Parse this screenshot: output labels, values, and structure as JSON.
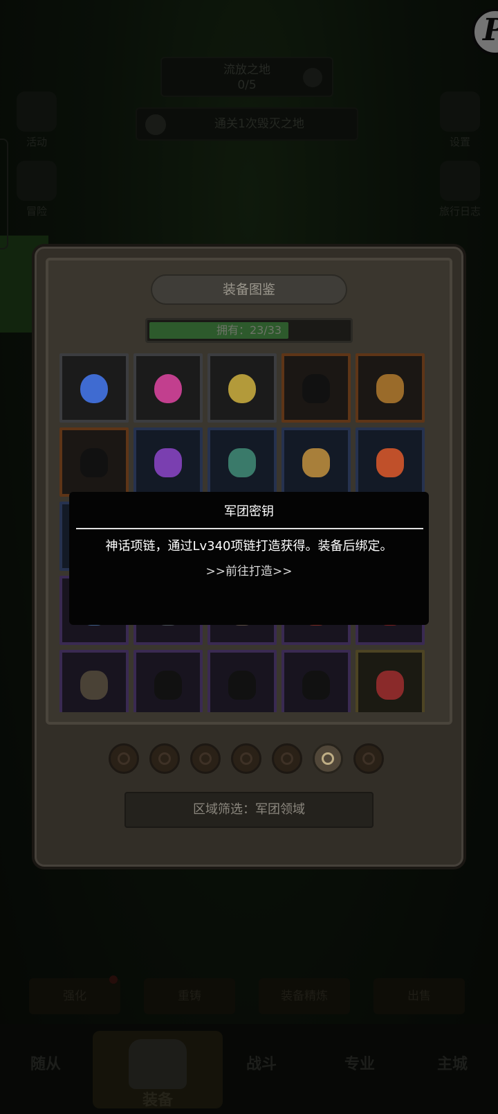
{
  "background": {
    "stage": {
      "name": "流放之地",
      "progress": "0/5"
    },
    "quest": "通关1次毁灭之地",
    "left_menu": [
      "活动",
      "冒险"
    ],
    "right_menu": [
      "设置",
      "旅行日志"
    ],
    "actions": [
      "强化",
      "重铸",
      "装备精炼",
      "出售"
    ],
    "tabs": [
      "随从",
      "装备",
      "战斗",
      "专业",
      "主城"
    ],
    "active_tab": "装备",
    "corner_logo": "P"
  },
  "panel": {
    "title": "装备图鉴",
    "owned_label": "拥有：23/33",
    "owned_fraction": 0.697,
    "grid": [
      [
        {
          "rarity": "grey",
          "icon": "blue-egg-necklace-icon",
          "color": "#3f6bd1"
        },
        {
          "rarity": "grey",
          "icon": "pink-egg-necklace-icon",
          "color": "#c23f8e"
        },
        {
          "rarity": "grey",
          "icon": "gold-egg-necklace-icon",
          "color": "#b39a3a"
        },
        {
          "rarity": "orange",
          "icon": "locked-silhouette-icon",
          "color": "#111111"
        },
        {
          "rarity": "orange",
          "icon": "winged-amulet-icon",
          "color": "#9a6b2a"
        }
      ],
      [
        {
          "rarity": "orange",
          "icon": "locked-silhouette-icon",
          "color": "#111111"
        },
        {
          "rarity": "blue",
          "icon": "purple-orb-amulet-icon",
          "color": "#7a3fb0"
        },
        {
          "rarity": "blue",
          "icon": "spiked-ring-amulet-icon",
          "color": "#3a7a6a"
        },
        {
          "rarity": "blue",
          "icon": "horned-amulet-icon",
          "color": "#a87f3a"
        },
        {
          "rarity": "blue",
          "icon": "ruby-locket-icon",
          "color": "#c0502a"
        }
      ],
      [
        {
          "rarity": "blue",
          "icon": "hidden-item-icon",
          "color": "#222222"
        },
        {
          "rarity": "blue",
          "icon": "hidden-item-icon",
          "color": "#222222"
        },
        {
          "rarity": "blue",
          "icon": "hidden-item-icon",
          "color": "#222222"
        },
        {
          "rarity": "blue",
          "icon": "hidden-item-icon",
          "color": "#222222"
        },
        {
          "rarity": "blue",
          "icon": "hidden-item-icon",
          "color": "#222222"
        }
      ],
      [
        {
          "rarity": "purple",
          "icon": "crystal-shard-icon",
          "color": "#3e5e88"
        },
        {
          "rarity": "purple",
          "icon": "silver-pendant-icon",
          "color": "#4a5258"
        },
        {
          "rarity": "purple",
          "icon": "knot-pendant-icon",
          "color": "#5a4e44"
        },
        {
          "rarity": "purple",
          "icon": "red-gem-pendant-icon",
          "color": "#7a2a22"
        },
        {
          "rarity": "purple",
          "icon": "red-claw-pendant-icon",
          "color": "#7a1e1e"
        }
      ],
      [
        {
          "rarity": "purple",
          "icon": "compass-amulet-icon",
          "color": "#4a4236"
        },
        {
          "rarity": "purple",
          "icon": "locked-silhouette-icon",
          "color": "#111111"
        },
        {
          "rarity": "purple",
          "icon": "locked-silhouette-icon",
          "color": "#111111"
        },
        {
          "rarity": "purple",
          "icon": "locked-silhouette-icon",
          "color": "#111111"
        },
        {
          "rarity": "gold",
          "icon": "heart-amulet-icon",
          "color": "#8a2a2a"
        }
      ]
    ],
    "categories": [
      {
        "icon": "helmet-category-icon",
        "active": false
      },
      {
        "icon": "weapon-category-icon",
        "active": false
      },
      {
        "icon": "armor-category-icon",
        "active": false
      },
      {
        "icon": "gloves-category-icon",
        "active": false
      },
      {
        "icon": "boots-category-icon",
        "active": false
      },
      {
        "icon": "necklace-category-icon",
        "active": true
      },
      {
        "icon": "ring-category-icon",
        "active": false
      }
    ],
    "filter_label": "区域筛选：军团领域"
  },
  "tooltip": {
    "title": "军团密钥",
    "description": "神话项链，通过Lv340项链打造获得。装备后绑定。",
    "link": ">>前往打造>>"
  }
}
